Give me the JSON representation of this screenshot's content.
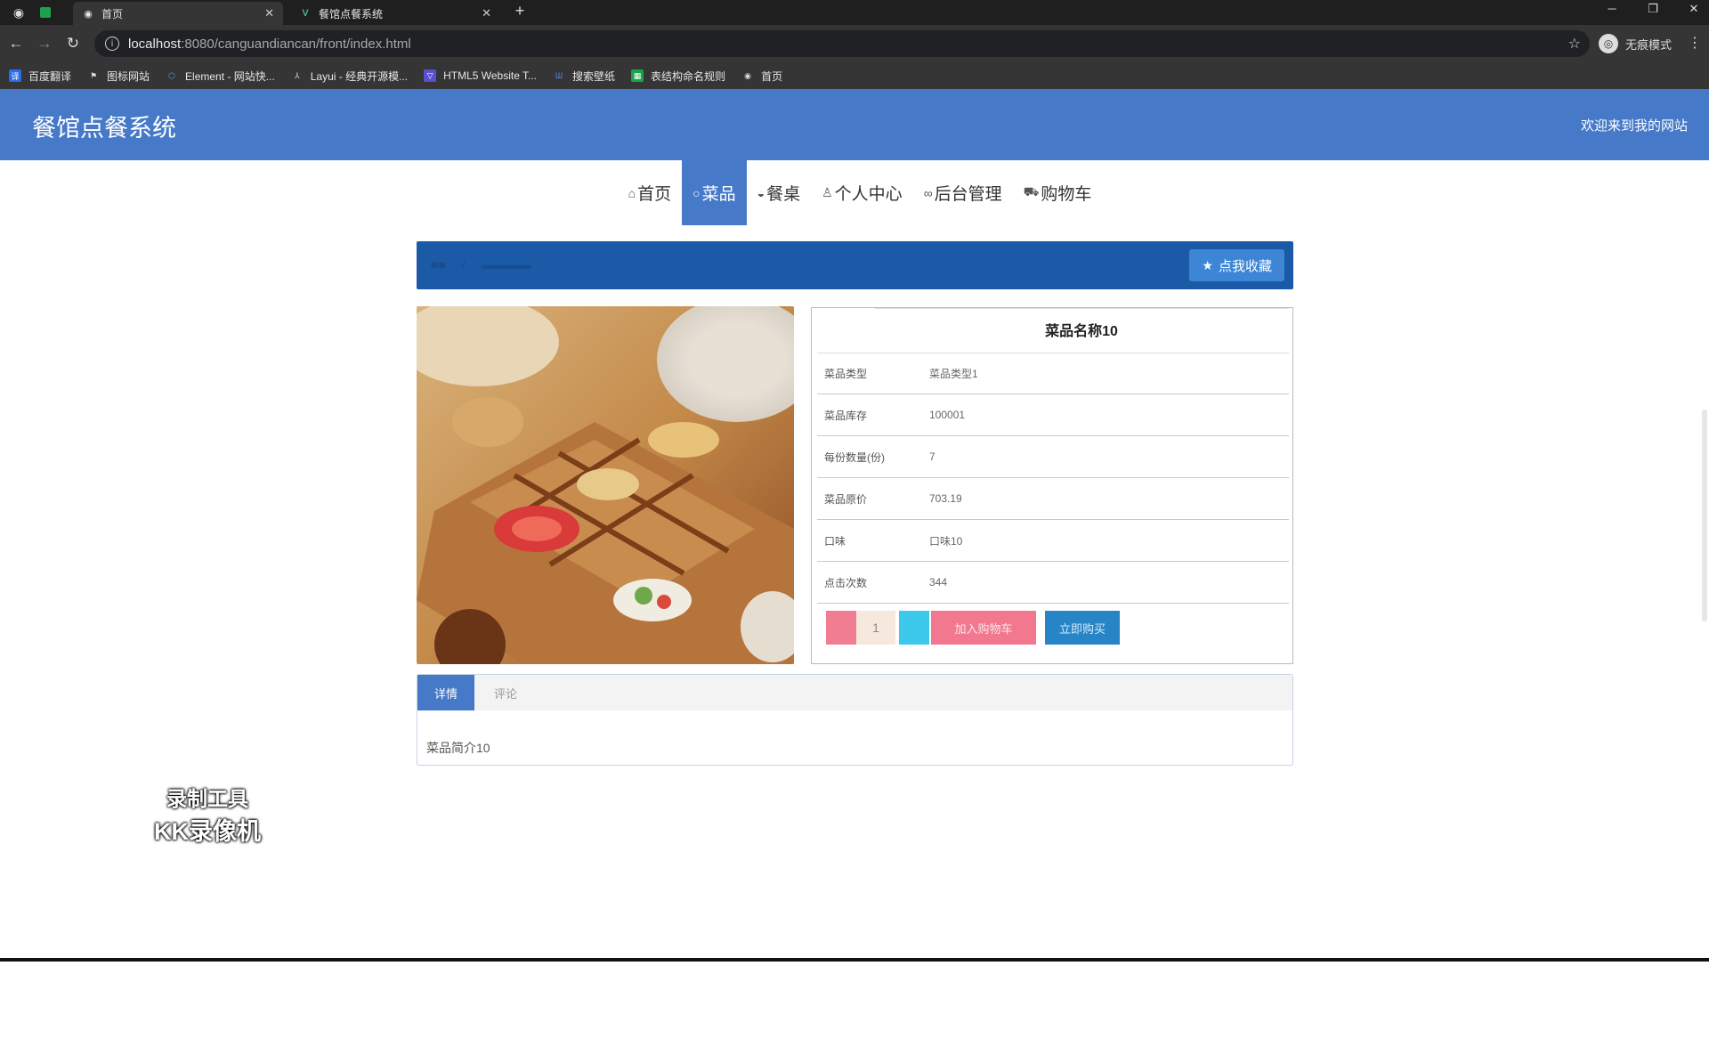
{
  "browser": {
    "tabs": [
      {
        "title": "首页",
        "active": true
      },
      {
        "title": "餐馆点餐系统",
        "active": false
      }
    ],
    "url_host": "localhost",
    "url_path": ":8080/canguandiancan/front/index.html",
    "mode_label": "无痕模式",
    "bookmarks": [
      {
        "label": "百度翻译",
        "icon": "translate-icon",
        "color": "#2b6de8"
      },
      {
        "label": "图标网站",
        "icon": "flag-icon",
        "color": "#353535"
      },
      {
        "label": "Element - 网站快...",
        "icon": "element-icon",
        "color": "#409eff"
      },
      {
        "label": "Layui - 经典开源模...",
        "icon": "layui-icon",
        "color": "#353535"
      },
      {
        "label": "HTML5 Website T...",
        "icon": "html5-icon",
        "color": "#5a4fcf"
      },
      {
        "label": "搜索壁纸",
        "icon": "wallpaper-icon",
        "color": "#2d6cc9"
      },
      {
        "label": "表结构命名规则",
        "icon": "table-icon",
        "color": "#1aa34a"
      },
      {
        "label": "首页",
        "icon": "globe-icon",
        "color": "#353535"
      }
    ]
  },
  "site": {
    "title": "餐馆点餐系统",
    "welcome": "欢迎来到我的网站",
    "nav": [
      {
        "label": "首页",
        "icon": "home-icon",
        "glyph": "⌂",
        "active": false
      },
      {
        "label": "菜品",
        "icon": "dish-icon",
        "glyph": "○",
        "active": true
      },
      {
        "label": "餐桌",
        "icon": "table-icon",
        "glyph": "◒",
        "active": false
      },
      {
        "label": "个人中心",
        "icon": "user-icon",
        "glyph": "♙",
        "active": false
      },
      {
        "label": "后台管理",
        "icon": "link-icon",
        "glyph": "∞",
        "active": false
      },
      {
        "label": "购物车",
        "icon": "cart-icon",
        "glyph": "⛟",
        "active": false
      }
    ],
    "favorite_button": "点我收藏"
  },
  "product": {
    "name": "菜品名称10",
    "fields": [
      {
        "label": "菜品类型",
        "value": "菜品类型1"
      },
      {
        "label": "菜品库存",
        "value": "100001"
      },
      {
        "label": "每份数量(份)",
        "value": "7"
      },
      {
        "label": "菜品原价",
        "value": "703.19"
      },
      {
        "label": "口味",
        "value": "口味10"
      },
      {
        "label": "点击次数",
        "value": "344"
      }
    ],
    "quantity": "1",
    "add_cart_label": "加入购物车",
    "buy_label": "立即购买"
  },
  "detail_tabs": [
    {
      "label": "详情",
      "active": true
    },
    {
      "label": "评论",
      "active": false
    }
  ],
  "detail_content": "菜品简介10",
  "watermark": {
    "line1": "录制工具",
    "line2": "KK录像机"
  }
}
